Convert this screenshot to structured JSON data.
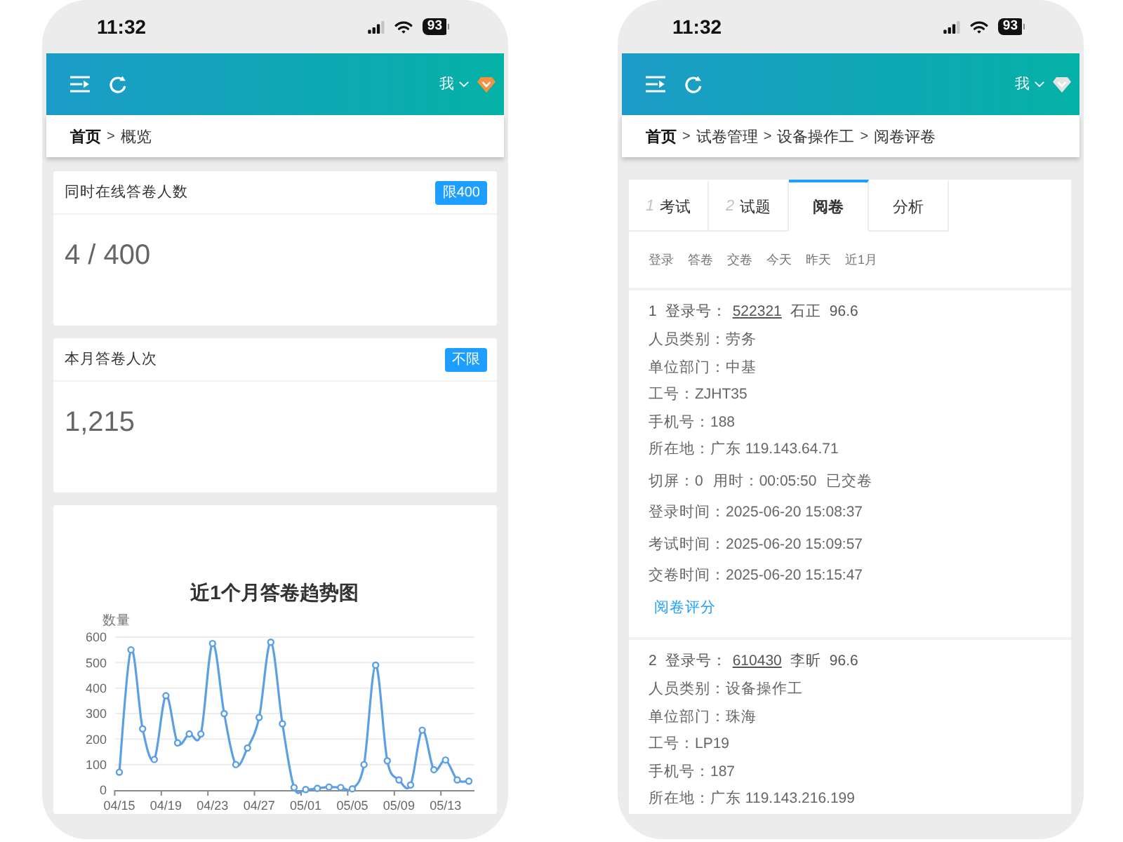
{
  "screens": [
    {
      "kind": "overview",
      "status_bar": {
        "time": "11:32",
        "battery": "93"
      },
      "header": {
        "user": "我",
        "user_badge": {
          "color": "#f6923f"
        }
      },
      "breadcrumb": {
        "separator": ">",
        "items": [
          "首页",
          "概览"
        ]
      },
      "stat_cards": [
        {
          "title": "同时在线答卷人数",
          "tag": "限400",
          "value": "4 / 400"
        },
        {
          "title": "本月答卷人次",
          "tag": "不限",
          "value": "1,215"
        }
      ],
      "chart_data": {
        "type": "line",
        "title": "近1个月答卷趋势图",
        "ylabel": "数量",
        "categories": [
          "04/15",
          null,
          null,
          null,
          "04/19",
          null,
          null,
          null,
          "04/23",
          null,
          null,
          null,
          "04/27",
          null,
          null,
          null,
          "05/01",
          null,
          null,
          null,
          "05/05",
          null,
          null,
          null,
          "05/09",
          null,
          null,
          null,
          "05/13",
          null,
          null
        ],
        "ylim": [
          0,
          600
        ],
        "yticks": [
          0,
          100,
          200,
          300,
          400,
          500,
          600
        ],
        "grid": true,
        "series": [
          {
            "color": "#5c9fe5",
            "marker": "circle",
            "values": [
              70,
              550,
              240,
              120,
              370,
              185,
              220,
              220,
              575,
              300,
              100,
              165,
              285,
              580,
              260,
              10,
              2,
              7,
              12,
              10,
              5,
              100,
              490,
              115,
              40,
              20,
              235,
              80,
              118,
              40,
              35
            ]
          }
        ]
      }
    },
    {
      "kind": "grading",
      "status_bar": {
        "time": "11:32",
        "battery": "93"
      },
      "header": {
        "user": "我",
        "user_badge": {
          "color": "#e3e3e3"
        }
      },
      "breadcrumb": {
        "separator": ">",
        "items": [
          "首页",
          "试卷管理",
          "设备操作工",
          "阅卷评卷"
        ]
      },
      "tabs": [
        {
          "step": "1",
          "label": "考试",
          "selected": false
        },
        {
          "step": "2",
          "label": "试题",
          "selected": false
        },
        {
          "label": "阅卷",
          "selected": true
        },
        {
          "label": "分析",
          "selected": false
        }
      ],
      "filters": [
        "登录",
        "答卷",
        "交卷",
        "今天",
        "昨天",
        "近1月"
      ],
      "records": [
        {
          "number": "1",
          "login_label": "登录号：",
          "login_id": "522321",
          "name": "石正",
          "score": "96.6",
          "details": [
            "人员类别：劳务",
            "单位部门：中基",
            "工号：ZJHT35",
            "手机号：188",
            "所在地：广东 119.143.64.71"
          ],
          "status": [
            "切屏：0",
            "用时：00:05:50",
            "已交卷"
          ],
          "times": [
            "登录时间：2025-06-20 15:08:37",
            "考试时间：2025-06-20 15:09:57",
            "交卷时间：2025-06-20 15:15:47"
          ],
          "action": "阅卷评分"
        },
        {
          "number": "2",
          "login_label": "登录号：",
          "login_id": "610430",
          "name": "李昕",
          "score": "96.6",
          "details": [
            "人员类别：设备操作工",
            "单位部门：珠海",
            "工号：LP19",
            "手机号：187",
            "所在地：广东 119.143.216.199"
          ]
        }
      ]
    }
  ]
}
